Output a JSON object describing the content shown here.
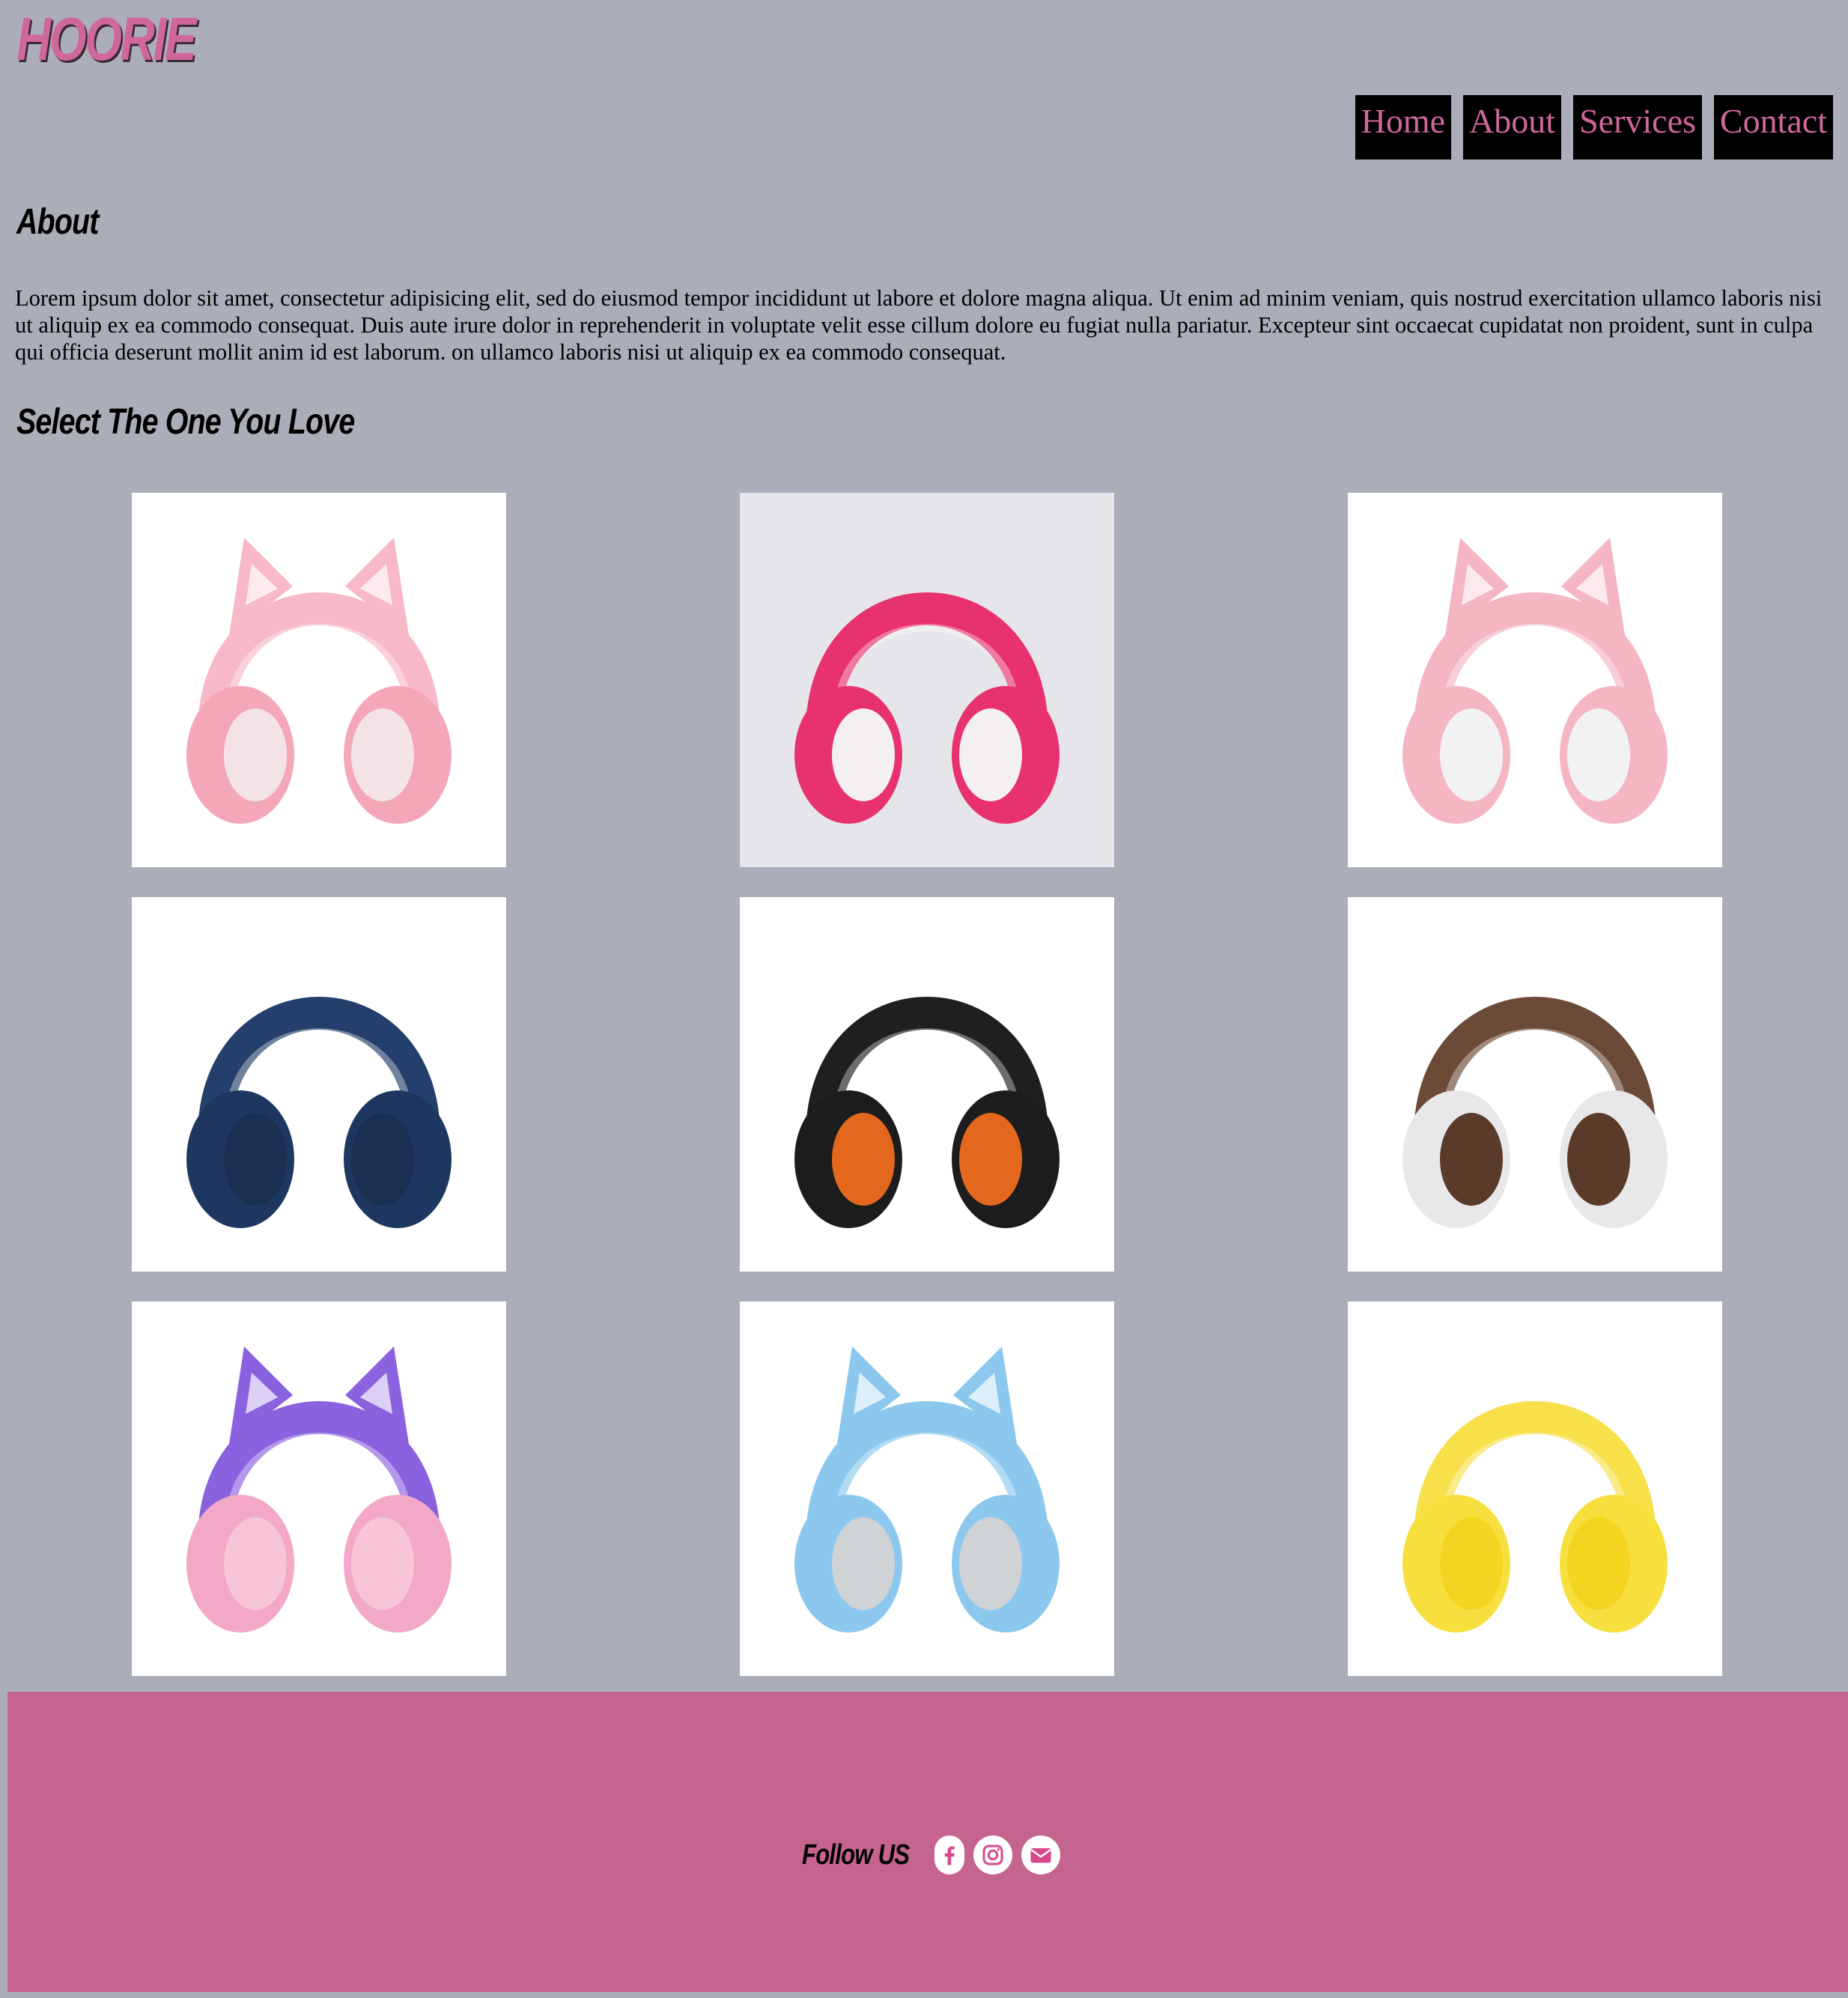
{
  "brand": {
    "logo": "HOORIE"
  },
  "nav": {
    "items": [
      {
        "label": "Home"
      },
      {
        "label": "About"
      },
      {
        "label": "Services"
      },
      {
        "label": "Contact"
      }
    ]
  },
  "about": {
    "title": "About",
    "text": "Lorem ipsum dolor sit amet, consectetur adipisicing elit, sed do eiusmod tempor incididunt ut labore et dolore magna aliqua. Ut enim ad minim veniam, quis nostrud exercitation ullamco laboris nisi ut aliquip ex ea commodo consequat. Duis aute irure dolor in reprehenderit in voluptate velit esse cillum dolore eu fugiat nulla pariatur. Excepteur sint occaecat cupidatat non proident, sunt in culpa qui officia deserunt mollit anim id est laborum. on ullamco laboris nisi ut aliquip ex ea commodo consequat."
  },
  "gallery": {
    "title": "Select The One You Love",
    "products": [
      {
        "icon": "pink-cat-ear-headset-image",
        "band": "#f7b9c8",
        "cup": "#f4a7b9",
        "pad": "#f3e3e6",
        "bg": "#ffffff",
        "ears": true
      },
      {
        "icon": "pink-kids-headphones-image",
        "band": "#e8326f",
        "cup": "#e8326f",
        "pad": "#f4f0f1",
        "bg": "#e6e6ea",
        "ears": false
      },
      {
        "icon": "pink-rgb-cat-ear-headset-image",
        "band": "#f5b6c4",
        "cup": "#f5b6c4",
        "pad": "#f2f2f2",
        "bg": "#ffffff",
        "ears": true
      },
      {
        "icon": "navy-blue-headphones-image",
        "band": "#243f6b",
        "cup": "#1e3760",
        "pad": "#1b2f52",
        "bg": "#ffffff",
        "ears": false
      },
      {
        "icon": "black-orange-headphones-image",
        "band": "#1f1f1f",
        "cup": "#1c1c1c",
        "pad": "#e3671c",
        "bg": "#ffffff",
        "ears": false
      },
      {
        "icon": "white-brown-headphones-image",
        "band": "#6b4a37",
        "cup": "#e8e8ea",
        "pad": "#5a3a28",
        "bg": "#ffffff",
        "ears": false
      },
      {
        "icon": "purple-cat-ear-kids-headphones-image",
        "band": "#8a62e0",
        "cup": "#f2a8c6",
        "pad": "#f7c5d7",
        "bg": "#ffffff",
        "ears": true
      },
      {
        "icon": "blue-cat-ear-headset-image",
        "band": "#8cc8ee",
        "cup": "#8cc8ee",
        "pad": "#cfd3d6",
        "bg": "#ffffff",
        "ears": true
      },
      {
        "icon": "yellow-headphones-image",
        "band": "#f7e04a",
        "cup": "#f7df3d",
        "pad": "#f3d420",
        "bg": "#ffffff",
        "ears": false
      }
    ]
  },
  "footer": {
    "follow_label": "Follow US",
    "social": [
      {
        "icon": "facebook-icon"
      },
      {
        "icon": "instagram-icon"
      },
      {
        "icon": "email-icon"
      }
    ],
    "icon_color": "#d64a8b"
  },
  "colors": {
    "page_bg": "#abaeb9",
    "accent": "#d0679b",
    "footer_bg": "#c66490",
    "nav_bg": "#000000"
  }
}
